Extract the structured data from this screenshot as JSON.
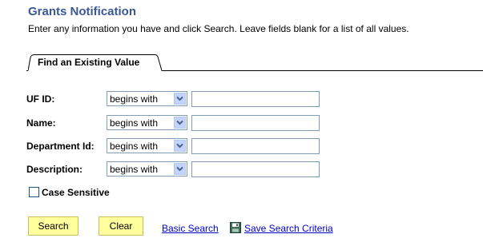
{
  "page": {
    "title": "Grants Notification",
    "instructions": "Enter any information you have and click Search. Leave fields blank for a list of all values."
  },
  "tab": {
    "label": "Find an Existing Value"
  },
  "fields": [
    {
      "label": "UF ID:",
      "operator": "begins with",
      "value": ""
    },
    {
      "label": "Name:",
      "operator": "begins with",
      "value": ""
    },
    {
      "label": "Department Id:",
      "operator": "begins with",
      "value": ""
    },
    {
      "label": "Description:",
      "operator": "begins with",
      "value": ""
    }
  ],
  "case_sensitive": {
    "label": "Case Sensitive",
    "checked": false
  },
  "actions": {
    "search_label": "Search",
    "clear_label": "Clear",
    "basic_search_label": "Basic Search",
    "save_criteria_label": "Save Search Criteria"
  },
  "icons": {
    "dropdown": "chevron-down-icon",
    "save": "floppy-disk-icon"
  },
  "colors": {
    "title": "#3a5795",
    "button_bg": "#ffff9e",
    "link": "#0000cc",
    "dropdown_button": "#c3d3fd"
  }
}
